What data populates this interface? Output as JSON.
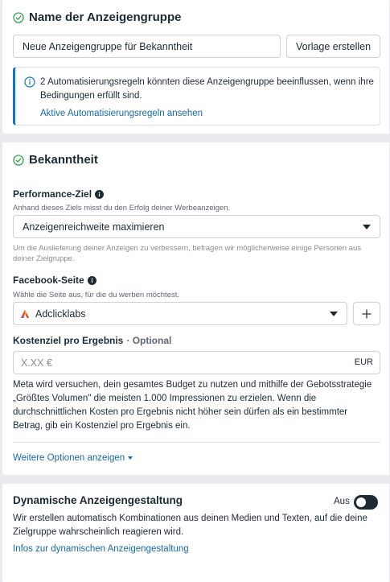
{
  "ad_group_name": {
    "title": "Name der Anzeigengruppe",
    "input_value": "Neue Anzeigengruppe für Bekanntheit",
    "template_button": "Vorlage erstellen",
    "info_text": "2 Automatisierungsregeln könnten diese Anzeigengruppe beeinflussen, wenn ihre Bedingungen erfüllt sind.",
    "info_link": "Aktive Automatisierungsregeln ansehen"
  },
  "awareness": {
    "title": "Bekanntheit",
    "performance_goal": {
      "label": "Performance-Ziel",
      "hint": "Anhand dieses Ziels misst du den Erfolg deiner Werbeanzeigen.",
      "selected": "Anzeigenreichweite maximieren",
      "note": "Um die Auslieferung deiner Anzeigen zu verbessern, befragen wir möglicherweise einige Personen aus deiner Zielgruppe."
    },
    "facebook_page": {
      "label": "Facebook-Seite",
      "hint": "Wähle die Seite aus, für die du werben möchtest.",
      "selected": "Adclicklabs"
    },
    "cost_goal": {
      "label": "Kostenziel pro Ergebnis",
      "optional": "· Optional",
      "placeholder": "X.XX €",
      "currency": "EUR",
      "description": "Meta wird versuchen, dein gesamtes Budget zu nutzen und mithilfe der Gebotsstrategie „Größtes Volumen\" die meisten 1.000 Impressionen zu erzielen. Wenn die durchschnittlichen Kosten pro Ergebnis nicht höher sein dürfen als ein bestimmter Betrag, gib ein Kostenziel pro Ergebnis ein."
    },
    "more_options": "Weitere Optionen anzeigen"
  },
  "dynamic_creative": {
    "title": "Dynamische Anzeigengestaltung",
    "toggle_label": "Aus",
    "toggle_state": "off",
    "description": "Wir erstellen automatisch Kombinationen aus deinen Medien und Texten, auf die deine Zielgruppe wahrscheinlich reagieren wird.",
    "link": "Infos zur dynamischen Anzeigengestaltung"
  },
  "colors": {
    "accent": "#1768ad",
    "success": "#31a24c",
    "text": "#1c2b33",
    "muted": "#606770"
  }
}
